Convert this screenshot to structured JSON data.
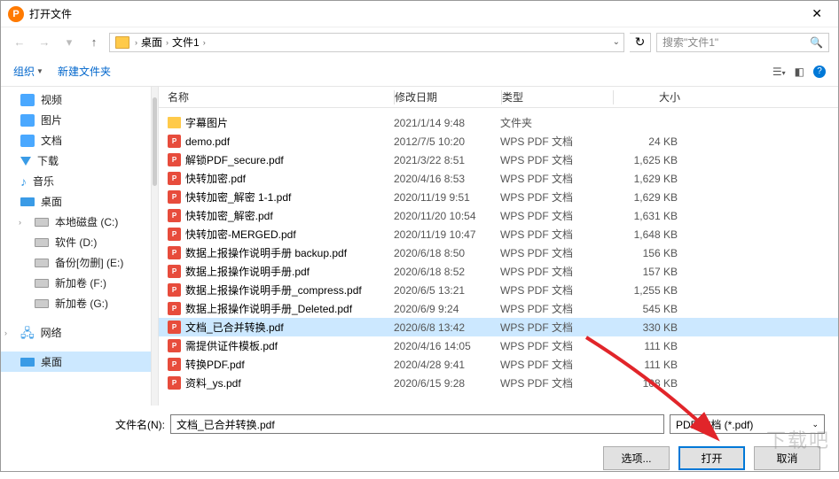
{
  "title": "打开文件",
  "breadcrumb": {
    "root": "桌面",
    "item": "文件1"
  },
  "search_placeholder": "搜索\"文件1\"",
  "toolbar": {
    "organize": "组织",
    "newfolder": "新建文件夹"
  },
  "sidebar": {
    "items": [
      {
        "label": "视频",
        "icon": "folder-b"
      },
      {
        "label": "图片",
        "icon": "folder-b"
      },
      {
        "label": "文档",
        "icon": "folder-b"
      },
      {
        "label": "下载",
        "icon": "down"
      },
      {
        "label": "音乐",
        "icon": "music"
      },
      {
        "label": "桌面",
        "icon": "desktop"
      },
      {
        "label": "本地磁盘 (C:)",
        "icon": "disk",
        "indent": true,
        "chev": true
      },
      {
        "label": "软件 (D:)",
        "icon": "disk",
        "indent": true
      },
      {
        "label": "备份[勿删] (E:)",
        "icon": "disk",
        "indent": true
      },
      {
        "label": "新加卷 (F:)",
        "icon": "disk",
        "indent": true
      },
      {
        "label": "新加卷 (G:)",
        "icon": "disk",
        "indent": true
      }
    ],
    "network": "网络",
    "desktop": "桌面"
  },
  "columns": {
    "name": "名称",
    "date": "修改日期",
    "type": "类型",
    "size": "大小"
  },
  "files": [
    {
      "name": "字幕图片",
      "date": "2021/1/14 9:48",
      "type": "文件夹",
      "size": "",
      "icon": "folder"
    },
    {
      "name": "demo.pdf",
      "date": "2012/7/5 10:20",
      "type": "WPS PDF 文档",
      "size": "24 KB",
      "icon": "pdf"
    },
    {
      "name": "解锁PDF_secure.pdf",
      "date": "2021/3/22 8:51",
      "type": "WPS PDF 文档",
      "size": "1,625 KB",
      "icon": "pdf"
    },
    {
      "name": "快转加密.pdf",
      "date": "2020/4/16 8:53",
      "type": "WPS PDF 文档",
      "size": "1,629 KB",
      "icon": "pdf"
    },
    {
      "name": "快转加密_解密 1-1.pdf",
      "date": "2020/11/19 9:51",
      "type": "WPS PDF 文档",
      "size": "1,629 KB",
      "icon": "pdf"
    },
    {
      "name": "快转加密_解密.pdf",
      "date": "2020/11/20 10:54",
      "type": "WPS PDF 文档",
      "size": "1,631 KB",
      "icon": "pdf"
    },
    {
      "name": "快转加密-MERGED.pdf",
      "date": "2020/11/19 10:47",
      "type": "WPS PDF 文档",
      "size": "1,648 KB",
      "icon": "pdf"
    },
    {
      "name": "数据上报操作说明手册 backup.pdf",
      "date": "2020/6/18 8:50",
      "type": "WPS PDF 文档",
      "size": "156 KB",
      "icon": "pdf"
    },
    {
      "name": "数据上报操作说明手册.pdf",
      "date": "2020/6/18 8:52",
      "type": "WPS PDF 文档",
      "size": "157 KB",
      "icon": "pdf"
    },
    {
      "name": "数据上报操作说明手册_compress.pdf",
      "date": "2020/6/5 13:21",
      "type": "WPS PDF 文档",
      "size": "1,255 KB",
      "icon": "pdf"
    },
    {
      "name": "数据上报操作说明手册_Deleted.pdf",
      "date": "2020/6/9 9:24",
      "type": "WPS PDF 文档",
      "size": "545 KB",
      "icon": "pdf"
    },
    {
      "name": "文档_已合并转换.pdf",
      "date": "2020/6/8 13:42",
      "type": "WPS PDF 文档",
      "size": "330 KB",
      "icon": "pdf",
      "selected": true
    },
    {
      "name": "需提供证件模板.pdf",
      "date": "2020/4/16 14:05",
      "type": "WPS PDF 文档",
      "size": "111 KB",
      "icon": "pdf"
    },
    {
      "name": "转换PDF.pdf",
      "date": "2020/4/28 9:41",
      "type": "WPS PDF 文档",
      "size": "111 KB",
      "icon": "pdf"
    },
    {
      "name": "资料_ys.pdf",
      "date": "2020/6/15 9:28",
      "type": "WPS PDF 文档",
      "size": "108 KB",
      "icon": "pdf"
    }
  ],
  "truncated_row": {
    "name": "………",
    "date": "2021/1/14 9:48",
    "type": "文件夹"
  },
  "filename_label": "文件名(N):",
  "filename_value": "文档_已合并转换.pdf",
  "filter_label": "PDF 文档 (*.pdf)",
  "buttons": {
    "options": "选项...",
    "open": "打开",
    "cancel": "取消"
  },
  "watermark": "下载吧"
}
